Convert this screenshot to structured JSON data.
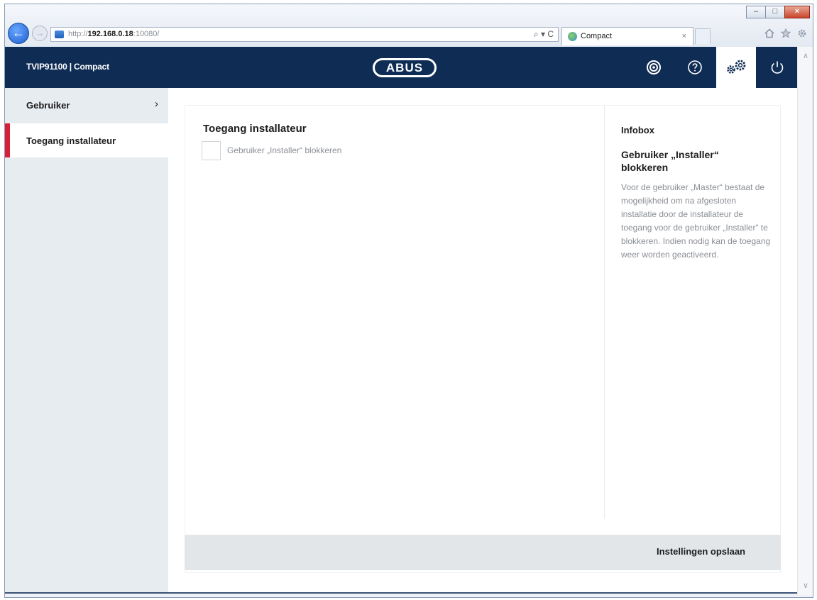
{
  "browser": {
    "url_prefix": "http://",
    "url_host": "192.168.0.18",
    "url_suffix": ":10080/",
    "address_actions": "⌕ ▾ C",
    "tab_title": "Compact",
    "tab_close": "×",
    "back_glyph": "←",
    "forward_glyph": "→",
    "controls": {
      "minimize": "–",
      "maximize": "□",
      "close": "×"
    },
    "tool_icons": [
      "home-icon",
      "star-icon",
      "gear-icon"
    ]
  },
  "app": {
    "title": "TVIP91100 | Compact",
    "brand": "ABUS",
    "header_buttons": [
      {
        "name": "camera",
        "icon": "camera-lens-icon"
      },
      {
        "name": "help",
        "icon": "help-circle-icon"
      },
      {
        "name": "settings",
        "icon": "gears-icon",
        "active": true
      },
      {
        "name": "power",
        "icon": "power-icon"
      }
    ],
    "colors": {
      "header": "#0f2c55",
      "accent": "#d72038",
      "sidebar": "#e7ecf1"
    }
  },
  "sidebar": {
    "items": [
      {
        "label": "Gebruiker",
        "chevron": "›"
      },
      {
        "label": "Toegang installateur",
        "active": true
      }
    ]
  },
  "main": {
    "section_title": "Toegang installateur",
    "checkbox_label": "Gebruiker „Installer“ blokkeren",
    "checkbox_checked": false,
    "infobox": {
      "heading": "Infobox",
      "subtitle": "Gebruiker „Installer“ blokkeren",
      "text": "Voor de gebruiker „Master“ bestaat de mogelijkheid om na afgesloten installatie door de installateur de toegang voor de gebruiker „Installer“ te blokkeren. Indien nodig kan de toegang weer worden geactiveerd."
    },
    "save_label": "Instellingen opslaan"
  },
  "scrollbar": {
    "up": "∧",
    "down": "∨"
  }
}
